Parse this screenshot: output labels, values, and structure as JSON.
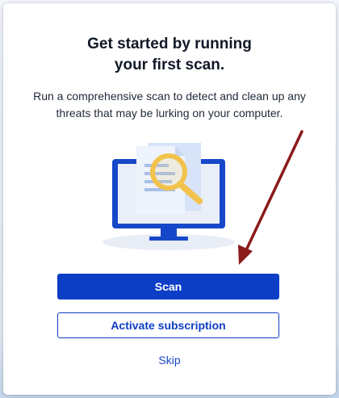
{
  "dialog": {
    "title_line1": "Get started by running",
    "title_line2": "your first scan.",
    "description": "Run a comprehensive scan to detect and clean up any threats that may be lurking on your computer.",
    "scan_button": "Scan",
    "activate_button": "Activate subscription",
    "skip_link": "Skip"
  },
  "colors": {
    "primary": "#0d3ec6",
    "illustration_blue": "#1747c9",
    "magnifier": "#f3c24d",
    "annotation_arrow": "#8b1a1a"
  },
  "icons": {
    "illustration": "monitor-with-document-and-magnifier",
    "annotation": "red-arrow-pointer"
  }
}
